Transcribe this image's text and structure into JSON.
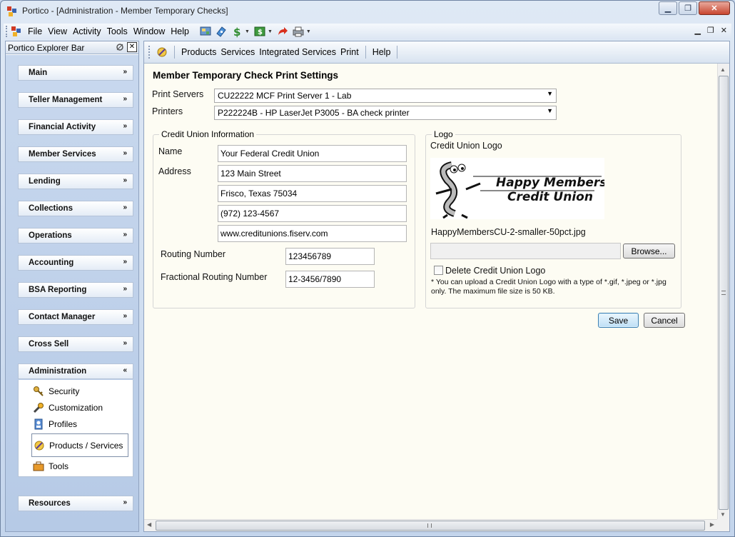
{
  "window": {
    "title": "Portico - [Administration - Member Temporary Checks]"
  },
  "menubar": {
    "items": [
      {
        "label": "File"
      },
      {
        "label": "View"
      },
      {
        "label": "Activity"
      },
      {
        "label": "Tools"
      },
      {
        "label": "Window"
      },
      {
        "label": "Help"
      }
    ],
    "toolbar_icons": [
      "teller-icon",
      "deposit-icon",
      "money-icon",
      "cash-drawer-icon",
      "forward-arrow-icon",
      "printer-icon"
    ]
  },
  "explorer": {
    "title": "Portico Explorer Bar",
    "sections": [
      {
        "label": "Main"
      },
      {
        "label": "Teller Management"
      },
      {
        "label": "Financial Activity"
      },
      {
        "label": "Member Services"
      },
      {
        "label": "Lending"
      },
      {
        "label": "Collections"
      },
      {
        "label": "Operations"
      },
      {
        "label": "Accounting"
      },
      {
        "label": "BSA Reporting"
      },
      {
        "label": "Contact Manager"
      },
      {
        "label": "Cross Sell"
      },
      {
        "label": "Administration"
      },
      {
        "label": "Resources"
      }
    ],
    "admin_items": [
      {
        "label": "Security",
        "icon": "key-icon"
      },
      {
        "label": "Customization",
        "icon": "wrench-icon"
      },
      {
        "label": "Profiles",
        "icon": "profile-icon"
      },
      {
        "label": "Products / Services",
        "icon": "products-icon"
      },
      {
        "label": "Tools",
        "icon": "toolbox-icon"
      }
    ]
  },
  "content_toolbar": {
    "items": [
      {
        "label": "Products"
      },
      {
        "label": "Services"
      },
      {
        "label": "Integrated Services"
      },
      {
        "label": "Print"
      },
      {
        "label": "Help"
      }
    ]
  },
  "form": {
    "title": "Member Temporary Check Print Settings",
    "print_servers_label": "Print Servers",
    "print_servers_value": "CU22222 MCF Print Server 1 - Lab",
    "printers_label": "Printers",
    "printers_value": "P222224B - HP LaserJet P3005 - BA check printer",
    "cu_info": {
      "legend": "Credit Union Information",
      "name_label": "Name",
      "name_value": "Your Federal Credit Union",
      "address_label": "Address",
      "address_lines": [
        "123 Main Street",
        "Frisco, Texas  75034",
        "(972) 123-4567",
        "www.creditunions.fiserv.com"
      ],
      "routing_label": "Routing Number",
      "routing_value": "123456789",
      "fractional_label": "Fractional Routing Number",
      "fractional_value": "12-3456/7890"
    },
    "logo": {
      "legend": "Logo",
      "cu_logo_label": "Credit Union Logo",
      "logo_text_line1": "Happy Members",
      "logo_text_line2": "Credit Union",
      "filename": "HappyMembersCU-2-smaller-50pct.jpg",
      "browse_label": "Browse...",
      "delete_label": "Delete Credit Union Logo",
      "note": "* You can upload a Credit Union Logo with a type of *.gif, *.jpeg or *.jpg only. The maximum file size is 50 KB."
    },
    "save_label": "Save",
    "cancel_label": "Cancel"
  },
  "colors": {
    "content_bg": "#fdfcf3",
    "explorer_bg": "#c8d8ee",
    "primary_button_border": "#3c7fb1"
  }
}
